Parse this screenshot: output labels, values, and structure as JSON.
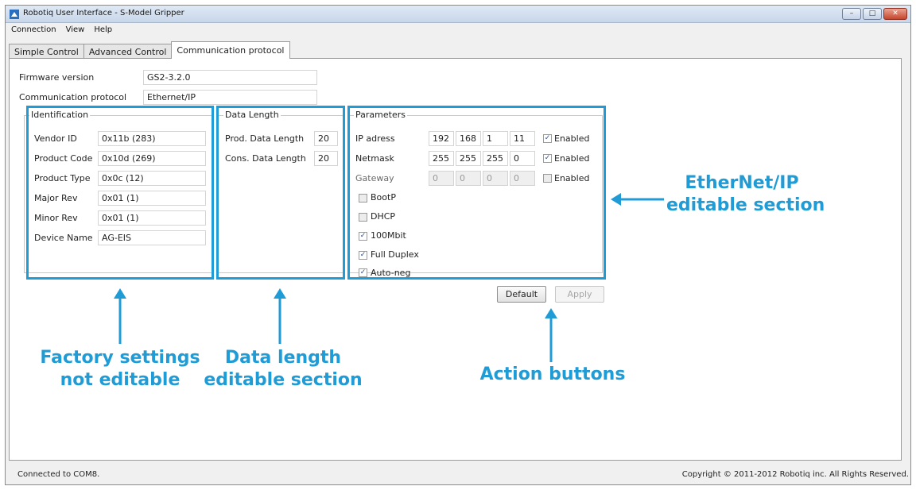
{
  "window": {
    "title": "Robotiq User Interface - S-Model Gripper",
    "accent": "#1f9bd6"
  },
  "menu": [
    "Connection",
    "View",
    "Help"
  ],
  "tabs": [
    {
      "label": "Simple Control",
      "active": false
    },
    {
      "label": "Advanced Control",
      "active": false
    },
    {
      "label": "Communication protocol",
      "active": true
    }
  ],
  "firmware": {
    "label": "Firmware version",
    "value": "GS2-3.2.0"
  },
  "protocol": {
    "label": "Communication protocol",
    "value": "Ethernet/IP"
  },
  "identification": {
    "title": "Identification",
    "rows": [
      {
        "label": "Vendor ID",
        "value": "0x11b (283)"
      },
      {
        "label": "Product Code",
        "value": "0x10d (269)"
      },
      {
        "label": "Product Type",
        "value": "0x0c (12)"
      },
      {
        "label": "Major Rev",
        "value": "0x01 (1)"
      },
      {
        "label": "Minor Rev",
        "value": "0x01 (1)"
      },
      {
        "label": "Device Name",
        "value": "AG-EIS"
      }
    ]
  },
  "data_length": {
    "title": "Data Length",
    "rows": [
      {
        "label": "Prod. Data Length",
        "value": "20"
      },
      {
        "label": "Cons. Data Length",
        "value": "20"
      }
    ]
  },
  "parameters": {
    "title": "Parameters",
    "ip_rows": [
      {
        "label": "IP adress",
        "octets": [
          "192",
          "168",
          "1",
          "11"
        ],
        "checkbox_label": "Enabled",
        "checked": true,
        "disabled": false
      },
      {
        "label": "Netmask",
        "octets": [
          "255",
          "255",
          "255",
          "0"
        ],
        "checkbox_label": "Enabled",
        "checked": true,
        "disabled": false
      },
      {
        "label": "Gateway",
        "octets": [
          "0",
          "0",
          "0",
          "0"
        ],
        "checkbox_label": "Enabled",
        "checked": false,
        "disabled": true
      }
    ],
    "options": [
      {
        "label": "BootP",
        "checked": false
      },
      {
        "label": "DHCP",
        "checked": false
      },
      {
        "label": "100Mbit",
        "checked": true
      },
      {
        "label": "Full Duplex",
        "checked": true
      },
      {
        "label": "Auto-neg",
        "checked": true
      }
    ]
  },
  "buttons": {
    "default_label": "Default",
    "apply_label": "Apply"
  },
  "annotations": {
    "factory": [
      "Factory settings",
      "not editable"
    ],
    "data_length": [
      "Data length",
      "editable section"
    ],
    "action": "Action buttons",
    "ethernet": [
      "EtherNet/IP",
      "editable section"
    ]
  },
  "status": {
    "connection": "Connected to COM8.",
    "copyright": "Copyright © 2011-2012 Robotiq inc. All Rights Reserved."
  }
}
